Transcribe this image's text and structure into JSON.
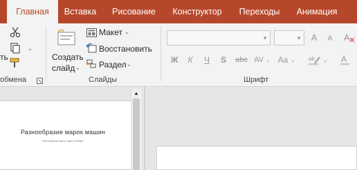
{
  "tabs": [
    {
      "label": "Главная",
      "active": true
    },
    {
      "label": "Вставка"
    },
    {
      "label": "Рисование"
    },
    {
      "label": "Конструктор"
    },
    {
      "label": "Переходы"
    },
    {
      "label": "Анимация"
    }
  ],
  "clipboard": {
    "paste_label": "ть",
    "group_label": "обмена"
  },
  "slides_group": {
    "new_slide_line1": "Создать",
    "new_slide_line2": "слайд",
    "layout_label": "Макет",
    "reset_label": "Восстановить",
    "section_label": "Раздел",
    "group_label": "Слайды"
  },
  "font_group": {
    "font_name": "",
    "font_size": "",
    "grow_label": "A",
    "shrink_label": "A",
    "bold": "Ж",
    "italic": "К",
    "underline": "Ч",
    "shadow": "S",
    "strike": "abc",
    "spacing": "AV",
    "case": "Aa",
    "group_label": "Шрифт"
  },
  "thumbnail": {
    "title": "Разнообразие марок машин",
    "subtitle": "Разнообразие марок, марка «Dodge»"
  },
  "colors": {
    "accent": "#b7472a",
    "ribbon_bg": "#f3f3f3",
    "workspace_bg": "#e6e6e6"
  }
}
